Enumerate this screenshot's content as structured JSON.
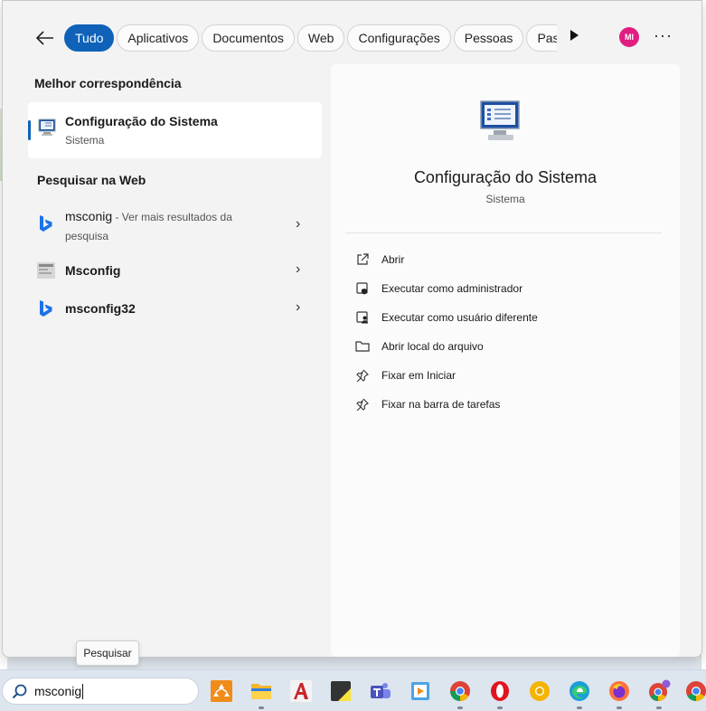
{
  "tabs": [
    {
      "label": "Tudo",
      "active": true
    },
    {
      "label": "Aplicativos"
    },
    {
      "label": "Documentos"
    },
    {
      "label": "Web"
    },
    {
      "label": "Configurações"
    },
    {
      "label": "Pessoas"
    },
    {
      "label": "Pas"
    }
  ],
  "avatar_initials": "MI",
  "best_match": {
    "heading": "Melhor correspondência",
    "title": "Configuração do Sistema",
    "subtitle": "Sistema",
    "icon": "system-config-icon"
  },
  "web_search": {
    "heading": "Pesquisar na Web",
    "items": [
      {
        "query": "msconig",
        "suffix": " - Ver mais resultados da",
        "suffix2": "pesquisa",
        "icon": "bing-icon"
      },
      {
        "query": "Msconfig",
        "icon": "page-thumb-icon"
      },
      {
        "query": "msconfig32",
        "icon": "bing-icon"
      }
    ]
  },
  "details": {
    "title": "Configuração do Sistema",
    "subtitle": "Sistema",
    "actions": [
      {
        "label": "Abrir",
        "icon": "open-external-icon"
      },
      {
        "label": "Executar como administrador",
        "icon": "shield-run-icon"
      },
      {
        "label": "Executar como usuário diferente",
        "icon": "user-run-icon"
      },
      {
        "label": "Abrir local do arquivo",
        "icon": "folder-icon"
      },
      {
        "label": "Fixar em Iniciar",
        "icon": "pin-icon"
      },
      {
        "label": "Fixar na barra de tarefas",
        "icon": "pin-icon"
      }
    ]
  },
  "tooltip": "Pesquisar",
  "taskbar": {
    "search_value": "msconig",
    "apps": [
      "lattice-app-icon",
      "file-explorer-icon",
      "autocad-icon",
      "sticky-notes-icon",
      "teams-icon",
      "media-icon",
      "chrome-icon",
      "opera-icon",
      "chrome-canary-icon",
      "edge-icon",
      "firefox-icon",
      "chrome-profile-icon",
      "chrome-icon-2"
    ]
  },
  "colors": {
    "accent": "#0f62b8",
    "avatar": "#e11d82"
  }
}
